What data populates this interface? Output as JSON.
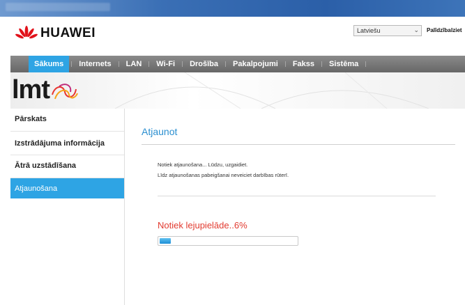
{
  "header": {
    "brand": "HUAWEI",
    "language_selected": "Latviešu",
    "help_label": "Palīdzība",
    "exit_label": "Iziet"
  },
  "nav": {
    "items": [
      {
        "label": "Sākums",
        "active": true
      },
      {
        "label": "Internets"
      },
      {
        "label": "LAN"
      },
      {
        "label": "Wi-Fi"
      },
      {
        "label": "Drošība"
      },
      {
        "label": "Pakalpojumi"
      },
      {
        "label": "Fakss"
      },
      {
        "label": "Sistēma"
      }
    ]
  },
  "banner": {
    "logo_text": "lmt"
  },
  "sidebar": {
    "items": [
      {
        "label": "Pārskats"
      },
      {
        "label": "Izstrādājuma informācija"
      },
      {
        "label": "Ātrā uzstādīšana"
      },
      {
        "label": "Atjaunošana",
        "active": true
      }
    ]
  },
  "main": {
    "title": "Atjaunot",
    "message_line1": "Notiek atjaunošana... Lūdzu, uzgaidiet.",
    "message_line2": "Līdz atjaunošanas pabeigšanai neveiciet darbības rūterī.",
    "download_status": "Notiek lejupielāde..6%",
    "progress_percent": 6
  },
  "colors": {
    "accent": "#2ea4e4",
    "nav_bg": "#777777",
    "status_red": "#e23a2f",
    "title_blue": "#2b8fd0"
  },
  "icons": {
    "brand": "huawei-petal-logo",
    "lmt": "lmt-ribbon-logo",
    "dropdown": "chevron-down-icon"
  }
}
